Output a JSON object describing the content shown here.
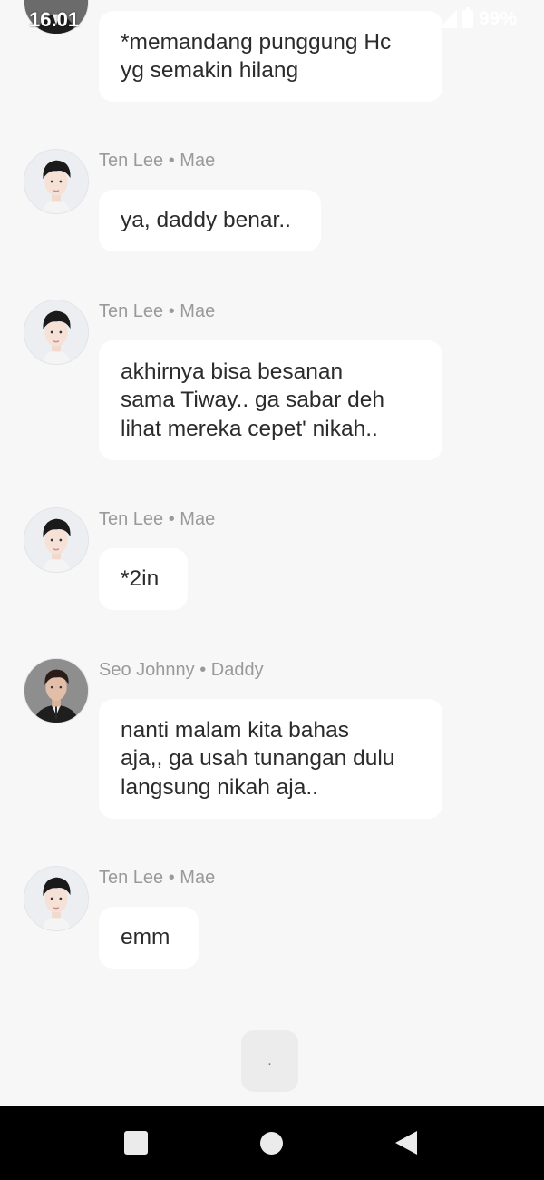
{
  "status_bar": {
    "time": "16.01",
    "battery": "99%"
  },
  "messages": [
    {
      "sender": "",
      "text": "*memandang punggung Hc\nyg semakin hilang",
      "avatar": "dark-suit"
    },
    {
      "sender": "Ten Lee • Mae",
      "text": "ya, daddy benar..",
      "avatar": "ten-lee"
    },
    {
      "sender": "Ten Lee • Mae",
      "text": "akhirnya bisa besanan\nsama Tiway.. ga sabar deh\nlihat mereka cepet' nikah..",
      "avatar": "ten-lee"
    },
    {
      "sender": "Ten Lee • Mae",
      "text": "*2in",
      "avatar": "ten-lee"
    },
    {
      "sender": "Seo Johnny • Daddy",
      "text": "nanti malam kita bahas\naja,, ga usah tunangan dulu\nlangsung nikah aja..",
      "avatar": "seo-johnny"
    },
    {
      "sender": "Ten Lee • Mae",
      "text": "emm",
      "avatar": "ten-lee"
    }
  ],
  "typing_indicator": {
    "text": "."
  },
  "colors": {
    "background": "#f7f7f7",
    "bubble": "#ffffff",
    "sender_text": "#9a9a9a",
    "nav_bar": "#000000"
  }
}
